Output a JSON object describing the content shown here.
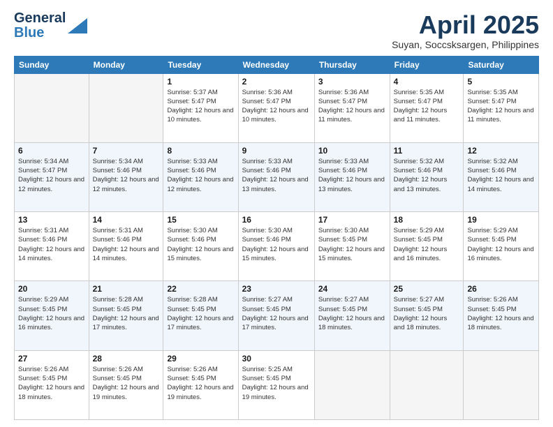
{
  "logo": {
    "general": "General",
    "blue": "Blue"
  },
  "title": {
    "month": "April 2025",
    "location": "Suyan, Soccsksargen, Philippines"
  },
  "headers": [
    "Sunday",
    "Monday",
    "Tuesday",
    "Wednesday",
    "Thursday",
    "Friday",
    "Saturday"
  ],
  "weeks": [
    [
      {
        "day": "",
        "info": ""
      },
      {
        "day": "",
        "info": ""
      },
      {
        "day": "1",
        "info": "Sunrise: 5:37 AM\nSunset: 5:47 PM\nDaylight: 12 hours and 10 minutes."
      },
      {
        "day": "2",
        "info": "Sunrise: 5:36 AM\nSunset: 5:47 PM\nDaylight: 12 hours and 10 minutes."
      },
      {
        "day": "3",
        "info": "Sunrise: 5:36 AM\nSunset: 5:47 PM\nDaylight: 12 hours and 11 minutes."
      },
      {
        "day": "4",
        "info": "Sunrise: 5:35 AM\nSunset: 5:47 PM\nDaylight: 12 hours and 11 minutes."
      },
      {
        "day": "5",
        "info": "Sunrise: 5:35 AM\nSunset: 5:47 PM\nDaylight: 12 hours and 11 minutes."
      }
    ],
    [
      {
        "day": "6",
        "info": "Sunrise: 5:34 AM\nSunset: 5:47 PM\nDaylight: 12 hours and 12 minutes."
      },
      {
        "day": "7",
        "info": "Sunrise: 5:34 AM\nSunset: 5:46 PM\nDaylight: 12 hours and 12 minutes."
      },
      {
        "day": "8",
        "info": "Sunrise: 5:33 AM\nSunset: 5:46 PM\nDaylight: 12 hours and 12 minutes."
      },
      {
        "day": "9",
        "info": "Sunrise: 5:33 AM\nSunset: 5:46 PM\nDaylight: 12 hours and 13 minutes."
      },
      {
        "day": "10",
        "info": "Sunrise: 5:33 AM\nSunset: 5:46 PM\nDaylight: 12 hours and 13 minutes."
      },
      {
        "day": "11",
        "info": "Sunrise: 5:32 AM\nSunset: 5:46 PM\nDaylight: 12 hours and 13 minutes."
      },
      {
        "day": "12",
        "info": "Sunrise: 5:32 AM\nSunset: 5:46 PM\nDaylight: 12 hours and 14 minutes."
      }
    ],
    [
      {
        "day": "13",
        "info": "Sunrise: 5:31 AM\nSunset: 5:46 PM\nDaylight: 12 hours and 14 minutes."
      },
      {
        "day": "14",
        "info": "Sunrise: 5:31 AM\nSunset: 5:46 PM\nDaylight: 12 hours and 14 minutes."
      },
      {
        "day": "15",
        "info": "Sunrise: 5:30 AM\nSunset: 5:46 PM\nDaylight: 12 hours and 15 minutes."
      },
      {
        "day": "16",
        "info": "Sunrise: 5:30 AM\nSunset: 5:46 PM\nDaylight: 12 hours and 15 minutes."
      },
      {
        "day": "17",
        "info": "Sunrise: 5:30 AM\nSunset: 5:45 PM\nDaylight: 12 hours and 15 minutes."
      },
      {
        "day": "18",
        "info": "Sunrise: 5:29 AM\nSunset: 5:45 PM\nDaylight: 12 hours and 16 minutes."
      },
      {
        "day": "19",
        "info": "Sunrise: 5:29 AM\nSunset: 5:45 PM\nDaylight: 12 hours and 16 minutes."
      }
    ],
    [
      {
        "day": "20",
        "info": "Sunrise: 5:29 AM\nSunset: 5:45 PM\nDaylight: 12 hours and 16 minutes."
      },
      {
        "day": "21",
        "info": "Sunrise: 5:28 AM\nSunset: 5:45 PM\nDaylight: 12 hours and 17 minutes."
      },
      {
        "day": "22",
        "info": "Sunrise: 5:28 AM\nSunset: 5:45 PM\nDaylight: 12 hours and 17 minutes."
      },
      {
        "day": "23",
        "info": "Sunrise: 5:27 AM\nSunset: 5:45 PM\nDaylight: 12 hours and 17 minutes."
      },
      {
        "day": "24",
        "info": "Sunrise: 5:27 AM\nSunset: 5:45 PM\nDaylight: 12 hours and 18 minutes."
      },
      {
        "day": "25",
        "info": "Sunrise: 5:27 AM\nSunset: 5:45 PM\nDaylight: 12 hours and 18 minutes."
      },
      {
        "day": "26",
        "info": "Sunrise: 5:26 AM\nSunset: 5:45 PM\nDaylight: 12 hours and 18 minutes."
      }
    ],
    [
      {
        "day": "27",
        "info": "Sunrise: 5:26 AM\nSunset: 5:45 PM\nDaylight: 12 hours and 18 minutes."
      },
      {
        "day": "28",
        "info": "Sunrise: 5:26 AM\nSunset: 5:45 PM\nDaylight: 12 hours and 19 minutes."
      },
      {
        "day": "29",
        "info": "Sunrise: 5:26 AM\nSunset: 5:45 PM\nDaylight: 12 hours and 19 minutes."
      },
      {
        "day": "30",
        "info": "Sunrise: 5:25 AM\nSunset: 5:45 PM\nDaylight: 12 hours and 19 minutes."
      },
      {
        "day": "",
        "info": ""
      },
      {
        "day": "",
        "info": ""
      },
      {
        "day": "",
        "info": ""
      }
    ]
  ]
}
